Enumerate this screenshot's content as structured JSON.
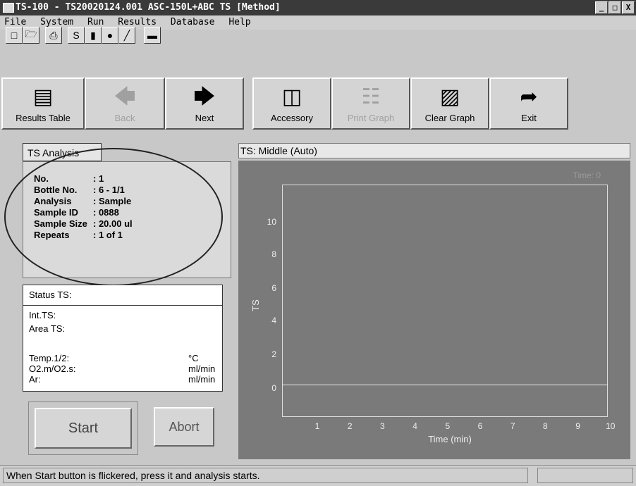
{
  "window": {
    "title": "TS-100 - TS20020124.001  ASC-150L+ABC TS [Method]",
    "controls": [
      "_",
      "□",
      "X"
    ]
  },
  "menu": [
    "File",
    "System",
    "Run",
    "Results",
    "Database",
    "Help"
  ],
  "toolbar_small": [
    "new-file-icon",
    "open-folder-icon",
    "printer-icon",
    "s-icon",
    "book-icon",
    "drop-icon",
    "pen-icon",
    "minus-icon"
  ],
  "toolbar_big": [
    {
      "label": "Results Table",
      "icon": "results-table-icon",
      "enabled": true
    },
    {
      "label": "Back",
      "icon": "back-arrow-icon",
      "enabled": false
    },
    {
      "label": "Next",
      "icon": "next-arrow-icon",
      "enabled": true
    },
    {
      "label": "Accessory",
      "icon": "accessory-icon",
      "enabled": true
    },
    {
      "label": "Print Graph",
      "icon": "print-graph-icon",
      "enabled": false
    },
    {
      "label": "Clear Graph",
      "icon": "clear-graph-icon",
      "enabled": true
    },
    {
      "label": "Exit",
      "icon": "exit-arrow-icon",
      "enabled": true
    }
  ],
  "analysis": {
    "tab": "TS Analysis",
    "rows": [
      {
        "key": "No.",
        "value": ": 1"
      },
      {
        "key": "Bottle No.",
        "value": ": 6 - 1/1"
      },
      {
        "key": "Analysis",
        "value": ": Sample"
      },
      {
        "key": "Sample ID",
        "value": ": 0888"
      },
      {
        "key": "Sample Size",
        "value": ": 20.00 ul"
      },
      {
        "key": "Repeats",
        "value": ": 1  of 1"
      }
    ]
  },
  "status": {
    "header": "Status TS:",
    "int": "Int.TS:",
    "area": "Area TS:",
    "temp": "Temp.1/2:",
    "o2": "O2.m/O2.s:",
    "ar": "Ar:",
    "temp_unit": "°C",
    "o2_unit": "ml/min",
    "ar_unit": "ml/min"
  },
  "buttons": {
    "start": "Start",
    "abort": "Abort"
  },
  "graph": {
    "title": "TS: Middle  (Auto)",
    "ylabel": "TS",
    "xlabel": "Time (min)",
    "corner": "Time: 0",
    "yticks": [
      "10",
      "8",
      "6",
      "4",
      "2",
      "0"
    ],
    "xticks": [
      "1",
      "2",
      "3",
      "4",
      "5",
      "6",
      "7",
      "8",
      "9",
      "10"
    ]
  },
  "statusbar": "When Start button is flickered, press it and analysis starts."
}
